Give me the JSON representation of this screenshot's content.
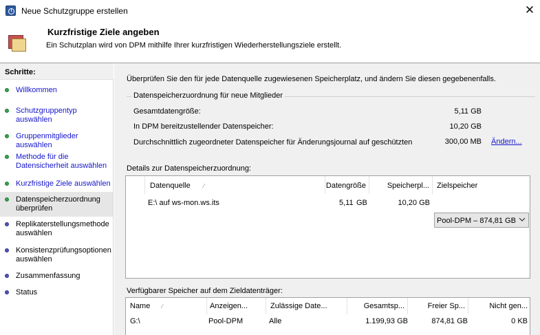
{
  "window": {
    "title": "Neue Schutzgruppe erstellen",
    "close_glyph": "✕"
  },
  "header": {
    "title": "Kurzfristige Ziele angeben",
    "subtitle": "Ein Schutzplan wird von DPM mithilfe Ihrer kurzfristigen Wiederherstellungsziele erstellt."
  },
  "steps": {
    "title": "Schritte:",
    "items": [
      {
        "label": "Willkommen",
        "status": "done"
      },
      {
        "label": "Schutzgruppentyp auswählen",
        "status": "done"
      },
      {
        "label": "Gruppenmitglieder auswählen",
        "status": "done"
      },
      {
        "label": "Methode für die Datensicherheit auswählen",
        "status": "done"
      },
      {
        "label": "Kurzfristige Ziele auswählen",
        "status": "done"
      },
      {
        "label": "Datenspeicherzuordnung überprüfen",
        "status": "current"
      },
      {
        "label": "Replikaterstellungsmethode auswählen",
        "status": "pending"
      },
      {
        "label": "Konsistenzprüfungsoptionen auswählen",
        "status": "pending"
      },
      {
        "label": "Zusammenfassung",
        "status": "pending"
      },
      {
        "label": "Status",
        "status": "pending"
      }
    ]
  },
  "main": {
    "intro": "Überprüfen Sie den für jede Datenquelle zugewiesenen Speicherplatz, und ändern Sie diesen gegebenenfalls.",
    "allocation": {
      "title": "Datenspeicherzuordnung für neue Mitglieder",
      "rows": [
        {
          "label": "Gesamtdatengröße:",
          "value": "5,11 GB"
        },
        {
          "label": "In DPM bereitzustellender Datenspeicher:",
          "value": "10,20 GB"
        },
        {
          "label": "Durchschnittlich zugeordneter Datenspeicher für Änderungsjournal auf geschützten Volumes:",
          "value": "300,00 MB"
        }
      ],
      "change_link": "Ändern..."
    },
    "details": {
      "title": "Details zur Datenspeicherzuordnung:",
      "columns": [
        "Datenquelle",
        "Datengröße",
        "Speicherpl...",
        "Zielspeicher"
      ],
      "rows": [
        {
          "source": "E:\\ auf ws-mon.ws.its",
          "size_num": "5,11",
          "size_unit": "GB",
          "storage": "10,20 GB",
          "target": "Pool-DPM – 874,81 GB"
        }
      ]
    },
    "available": {
      "title": "Verfügbarer Speicher auf dem Zieldatenträger:",
      "columns": [
        "Name",
        "Anzeigen...",
        "Zulässige Date...",
        "Gesamtsp...",
        "Freier Sp...",
        "Nicht gen..."
      ],
      "rows": [
        {
          "name": "G:\\",
          "display": "Pool-DPM",
          "allowed": "Alle",
          "total": "1.199,93 GB",
          "free": "874,81 GB",
          "unused": "0 KB"
        }
      ]
    }
  },
  "colors": {
    "link": "#1515cc",
    "done_dot": "#34a34a",
    "pending_dot": "#5252c0",
    "panel_bg": "#f0f0f0"
  },
  "icons": [
    "app-clock-icon",
    "close-icon",
    "protection-group-icon",
    "sort-ascending-icon",
    "chevron-down-icon"
  ]
}
